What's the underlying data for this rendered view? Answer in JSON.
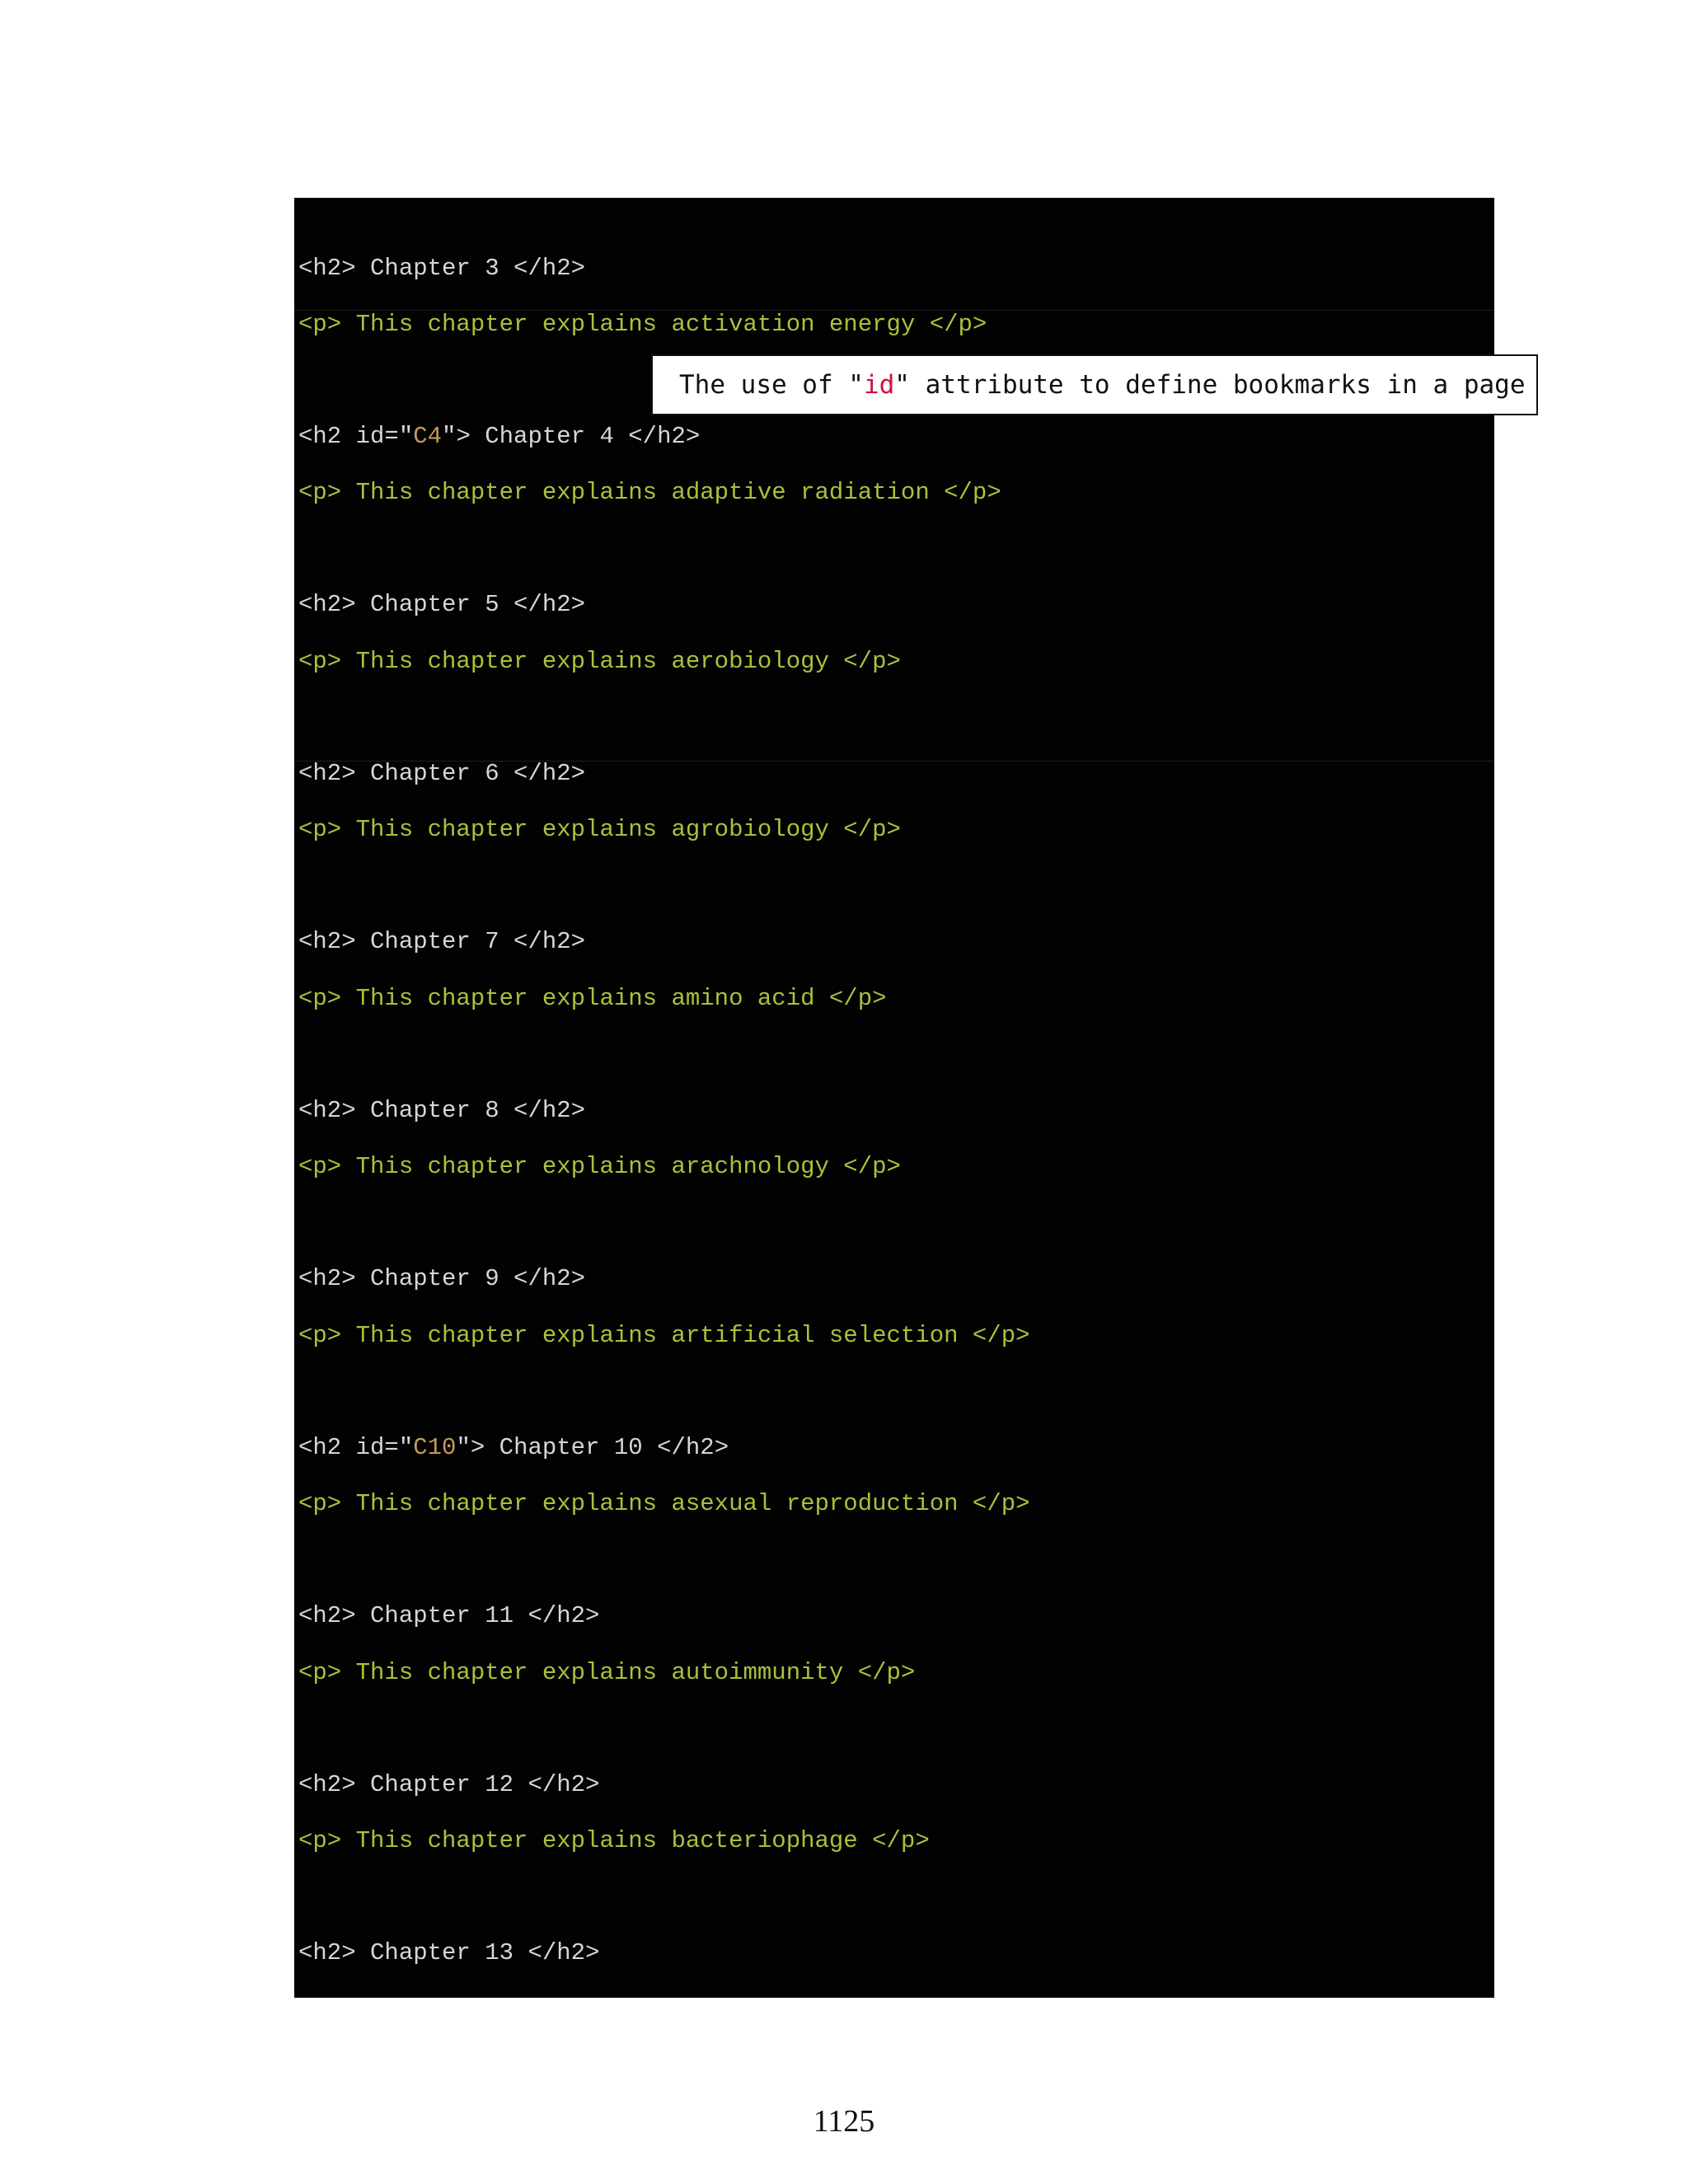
{
  "code_lines": [
    {
      "kind": "h2",
      "text": "<h2> Chapter 3 </h2>"
    },
    {
      "kind": "p",
      "text": "<p> This chapter explains activation energy </p>"
    },
    {
      "kind": "h2",
      "pre": "<h2 id=\"",
      "id": "C4",
      "post": "\"> Chapter 4 </h2>"
    },
    {
      "kind": "p",
      "text": "<p> This chapter explains adaptive radiation </p>"
    },
    {
      "kind": "h2",
      "text": "<h2> Chapter 5 </h2>"
    },
    {
      "kind": "p",
      "text": "<p> This chapter explains aerobiology </p>"
    },
    {
      "kind": "h2",
      "text": "<h2> Chapter 6 </h2>"
    },
    {
      "kind": "p",
      "text": "<p> This chapter explains agrobiology </p>"
    },
    {
      "kind": "h2",
      "text": "<h2> Chapter 7 </h2>"
    },
    {
      "kind": "p",
      "text": "<p> This chapter explains amino acid </p>"
    },
    {
      "kind": "h2",
      "text": "<h2> Chapter 8 </h2>"
    },
    {
      "kind": "p",
      "text": "<p> This chapter explains arachnology </p>"
    },
    {
      "kind": "h2",
      "text": "<h2> Chapter 9 </h2>"
    },
    {
      "kind": "p",
      "text": "<p> This chapter explains artificial selection </p>"
    },
    {
      "kind": "h2",
      "pre": "<h2 id=\"",
      "id": "C10",
      "post": "\"> Chapter 10 </h2>"
    },
    {
      "kind": "p",
      "text": "<p> This chapter explains asexual reproduction </p>"
    },
    {
      "kind": "h2",
      "text": "<h2> Chapter 11 </h2>"
    },
    {
      "kind": "p",
      "text": "<p> This chapter explains autoimmunity </p>"
    },
    {
      "kind": "h2",
      "text": "<h2> Chapter 12 </h2>"
    },
    {
      "kind": "p",
      "text": "<p> This chapter explains bacteriophage </p>"
    },
    {
      "kind": "h2",
      "text": "<h2> Chapter 13 </h2>"
    }
  ],
  "callout": {
    "before": "The use of \"",
    "highlight": "id",
    "after": "\" attribute to define bookmarks in a page"
  },
  "page_number": "1125",
  "colors": {
    "panel_background": "#020202",
    "h2_text": "#d6d6d6",
    "p_text": "#aebf3a",
    "id_value": "#c49a5a",
    "callout_highlight": "#d01040"
  }
}
